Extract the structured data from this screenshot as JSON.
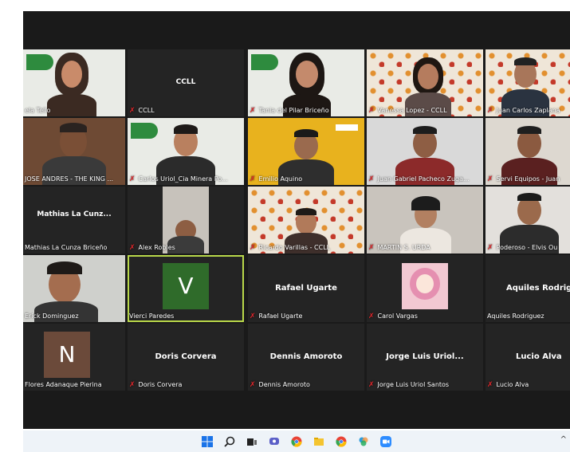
{
  "participants": [
    {
      "name": "ela Tello",
      "muted": false,
      "type": "video"
    },
    {
      "name": "CCLL",
      "big": "CCLL",
      "muted": true,
      "type": "name"
    },
    {
      "name": "Tania del Pilar Briceño",
      "muted": true,
      "type": "video"
    },
    {
      "name": "Vanessa Lopez - CCLL",
      "muted": true,
      "type": "video"
    },
    {
      "name": "Juan Carlos Zaplana",
      "muted": true,
      "type": "video"
    },
    {
      "name": "JOSE ANDRES - THE KING ...",
      "muted": false,
      "type": "video"
    },
    {
      "name": "Carlos Uriol_Cia Minera Po...",
      "muted": true,
      "type": "video"
    },
    {
      "name": "Emilio Aquino",
      "muted": true,
      "type": "video"
    },
    {
      "name": "Juan Gabriel Pacheco Zuga...",
      "muted": true,
      "type": "video"
    },
    {
      "name": "Servi Equipos - Juan",
      "muted": true,
      "type": "video"
    },
    {
      "name": "Mathias La Cunza Briceño",
      "big": "Mathias La Cunz...",
      "muted": false,
      "type": "name"
    },
    {
      "name": "Alex Robles",
      "muted": true,
      "type": "video"
    },
    {
      "name": "Ricardo Varillas - CCLL",
      "muted": true,
      "type": "video"
    },
    {
      "name": "MARTIN S. URDA",
      "muted": true,
      "type": "video"
    },
    {
      "name": "Poderoso - Elvis Ou",
      "muted": true,
      "type": "video"
    },
    {
      "name": "Erick Dominguez",
      "muted": false,
      "type": "video"
    },
    {
      "name": "Vierci Paredes",
      "avatar": "V",
      "avatar_color": "#2f6b2a",
      "muted": false,
      "type": "avatar",
      "active": true
    },
    {
      "name": "Rafael Ugarte",
      "big": "Rafael Ugarte",
      "muted": true,
      "type": "name"
    },
    {
      "name": "Carol Vargas",
      "muted": true,
      "type": "image"
    },
    {
      "name": "Aquiles Rodriguez",
      "big": "Aquiles Rodrigu",
      "muted": false,
      "type": "name"
    },
    {
      "name": "Flores Adanaque Pierina",
      "avatar": "N",
      "avatar_color": "#6b4a3a",
      "muted": false,
      "type": "avatar"
    },
    {
      "name": "Doris Corvera",
      "big": "Doris Corvera",
      "muted": true,
      "type": "name"
    },
    {
      "name": "Dennis Amoroto",
      "big": "Dennis Amoroto",
      "muted": true,
      "type": "name"
    },
    {
      "name": "Jorge Luis Uriol Santos",
      "big": "Jorge Luis Uriol...",
      "muted": true,
      "type": "name"
    },
    {
      "name": "Lucio Alva",
      "big": "Lucio Alva",
      "muted": true,
      "type": "name"
    }
  ],
  "taskbar": {
    "icons": [
      "windows-start-icon",
      "search-icon",
      "task-view-icon",
      "chat-icon",
      "chrome-icon",
      "file-explorer-icon",
      "chrome-icon-2",
      "photos-icon",
      "zoom-icon"
    ],
    "chevron": "^"
  }
}
